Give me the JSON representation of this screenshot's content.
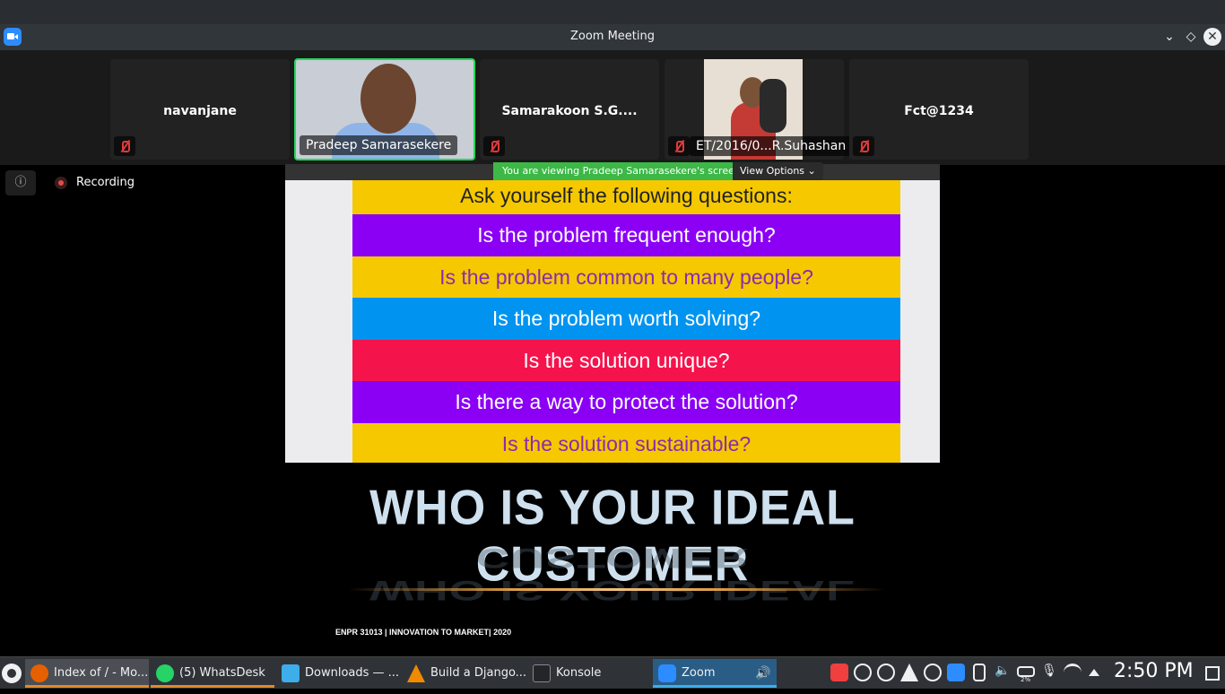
{
  "window": {
    "title": "Zoom Meeting"
  },
  "participants": [
    {
      "name": "navanjane",
      "muted": true
    },
    {
      "name": "Pradeep Samarasekere",
      "muted": false,
      "active": true
    },
    {
      "name": "Samarakoon S.G....",
      "muted": true
    },
    {
      "name": "ET/2016/0...R.Suhashan",
      "muted": true
    },
    {
      "name": "Fct@1234",
      "muted": true
    }
  ],
  "share": {
    "banner": "You are viewing Pradeep Samarasekere's screen",
    "view_options": "View Options"
  },
  "recording": {
    "label": "Recording"
  },
  "slide": {
    "rows": [
      {
        "text": "Ask yourself the following questions:",
        "bg": "#f5c800",
        "fg": "#222222"
      },
      {
        "text": "Is the problem frequent enough?",
        "bg": "#8b00f5",
        "fg": "#ffffff"
      },
      {
        "text": "Is the problem common to many people?",
        "bg": "#f5c800",
        "fg": "#8b2ab0"
      },
      {
        "text": "Is the problem worth solving?",
        "bg": "#0094f0",
        "fg": "#ffffff"
      },
      {
        "text": "Is the solution unique?",
        "bg": "#f5134c",
        "fg": "#ffffff"
      },
      {
        "text": "Is there a way to protect the solution?",
        "bg": "#8b00f5",
        "fg": "#ffffff"
      },
      {
        "text": "Is the solution sustainable?",
        "bg": "#f5c800",
        "fg": "#8b2ab0"
      }
    ],
    "title": "WHO IS YOUR IDEAL CUSTOMER",
    "footer": "ENPR 31013 | INNOVATION TO MARKET| 2020"
  },
  "taskbar": {
    "tasks": [
      {
        "label": "Index of / - Mo...",
        "icon": "firefox-icon",
        "color": "#e66000"
      },
      {
        "label": "(5) WhatsDesk",
        "icon": "whatsapp-icon",
        "color": "#25d366"
      },
      {
        "label": "Downloads — ...",
        "icon": "folder-icon",
        "color": "#3daee9"
      },
      {
        "label": "Build a Django...",
        "icon": "vlc-icon",
        "color": "#f08a00"
      },
      {
        "label": "Konsole",
        "icon": "terminal-icon",
        "color": "#232629"
      },
      {
        "label": "Zoom",
        "icon": "zoom-icon",
        "color": "#2d8cff"
      }
    ],
    "tray_icons": [
      "anydesk-icon",
      "pause-icon",
      "update-icon",
      "vlc-tray-icon",
      "whatsapp-tray-icon",
      "zoom-tray-icon",
      "clipboard-icon",
      "volume-icon",
      "battery-icon",
      "mic-icon",
      "wifi-icon",
      "expand-tray-icon"
    ],
    "battery_label": "2%",
    "clock": "2:50 PM"
  }
}
